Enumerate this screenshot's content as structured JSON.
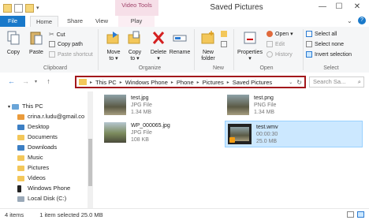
{
  "window": {
    "title": "Saved Pictures",
    "context_tab": "Video Tools",
    "min": "—",
    "max": "☐",
    "close": "✕"
  },
  "ribbon_tabs": [
    "File",
    "Home",
    "Share",
    "View",
    "Play"
  ],
  "ribbon": {
    "clipboard": {
      "label": "Clipboard",
      "copy": "Copy",
      "paste": "Paste",
      "cut": "Cut",
      "copy_path": "Copy path",
      "paste_shortcut": "Paste shortcut"
    },
    "organize": {
      "label": "Organize",
      "move_to": [
        "Move",
        "to ▾"
      ],
      "copy_to": [
        "Copy",
        "to ▾"
      ],
      "delete": [
        "Delete",
        "▾"
      ],
      "rename": "Rename"
    },
    "new": {
      "label": "New",
      "new_folder": [
        "New",
        "folder"
      ]
    },
    "open": {
      "label": "Open",
      "properties": [
        "Properties",
        "▾"
      ],
      "open": "Open ▾",
      "edit": "Edit",
      "history": "History"
    },
    "select": {
      "label": "Select",
      "select_all": "Select all",
      "select_none": "Select none",
      "invert": "Invert selection"
    }
  },
  "address": {
    "crumbs": [
      "This PC",
      "Windows Phone",
      "Phone",
      "Pictures",
      "Saved Pictures"
    ],
    "search_placeholder": "Search Sa..."
  },
  "nav_pane": {
    "items": [
      {
        "label": "This PC"
      },
      {
        "label": "crina.r.ludu@gmail.co"
      },
      {
        "label": "Desktop"
      },
      {
        "label": "Documents"
      },
      {
        "label": "Downloads"
      },
      {
        "label": "Music"
      },
      {
        "label": "Pictures"
      },
      {
        "label": "Videos"
      },
      {
        "label": "Windows Phone"
      },
      {
        "label": "Local Disk (C:)"
      }
    ]
  },
  "files": [
    {
      "name": "test.jpg",
      "type": "JPG File",
      "size": "1.34 MB"
    },
    {
      "name": "test.png",
      "type": "PNG File",
      "size": "1.34 MB"
    },
    {
      "name": "WP_000065.jpg",
      "type": "JPG File",
      "size": "108 KB"
    },
    {
      "name": "test.wmv",
      "type": "00:00:30",
      "size": "25.0 MB"
    }
  ],
  "status": {
    "count": "4 items",
    "selection": "1 item selected  25.0 MB"
  },
  "colors": {
    "file_tab": "#1979ca",
    "address_highlight": "#a3181c",
    "selection": "#cce8ff",
    "context_tab": "#f6dfe8"
  }
}
